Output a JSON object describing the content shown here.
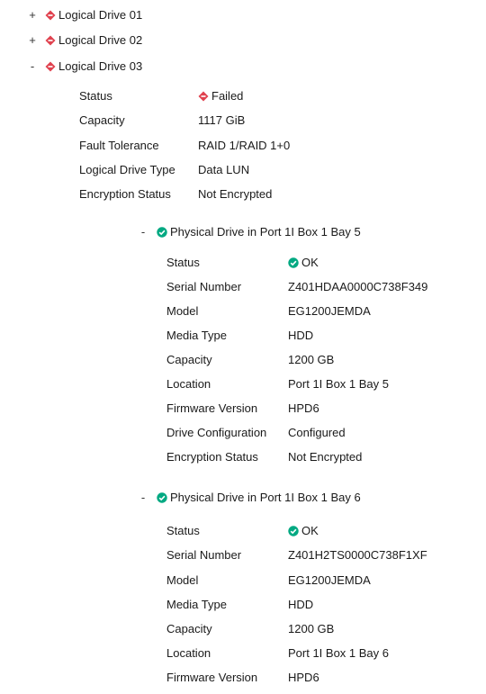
{
  "colors": {
    "failed": "#e0424f",
    "ok": "#01a982"
  },
  "logical_drives": [
    {
      "toggle": "+",
      "name": "Logical Drive 01",
      "status_icon": "failed-icon"
    },
    {
      "toggle": "+",
      "name": "Logical Drive 02",
      "status_icon": "failed-icon"
    },
    {
      "toggle": "-",
      "name": "Logical Drive 03",
      "status_icon": "failed-icon",
      "properties": [
        {
          "label": "Status",
          "value": "Failed",
          "icon": "failed-icon"
        },
        {
          "label": "Capacity",
          "value": "1117 GiB"
        },
        {
          "label": "Fault Tolerance",
          "value": "RAID 1/RAID 1+0"
        },
        {
          "label": "Logical Drive Type",
          "value": "Data LUN"
        },
        {
          "label": "Encryption Status",
          "value": "Not Encrypted"
        }
      ],
      "physical_drives": [
        {
          "toggle": "-",
          "name": "Physical Drive in Port 1I Box 1 Bay 5",
          "status_icon": "ok-icon",
          "properties": [
            {
              "label": "Status",
              "value": "OK",
              "icon": "ok-icon"
            },
            {
              "label": "Serial Number",
              "value": "Z401HDAA0000C738F349"
            },
            {
              "label": "Model",
              "value": "EG1200JEMDA"
            },
            {
              "label": "Media Type",
              "value": "HDD"
            },
            {
              "label": "Capacity",
              "value": "1200 GB"
            },
            {
              "label": "Location",
              "value": "Port 1I Box 1 Bay 5"
            },
            {
              "label": "Firmware Version",
              "value": "HPD6"
            },
            {
              "label": "Drive Configuration",
              "value": "Configured"
            },
            {
              "label": "Encryption Status",
              "value": "Not Encrypted"
            }
          ]
        },
        {
          "toggle": "-",
          "name": "Physical Drive in Port 1I Box 1 Bay 6",
          "status_icon": "ok-icon",
          "properties": [
            {
              "label": "Status",
              "value": "OK",
              "icon": "ok-icon"
            },
            {
              "label": "Serial Number",
              "value": "Z401H2TS0000C738F1XF"
            },
            {
              "label": "Model",
              "value": "EG1200JEMDA"
            },
            {
              "label": "Media Type",
              "value": "HDD"
            },
            {
              "label": "Capacity",
              "value": "1200 GB"
            },
            {
              "label": "Location",
              "value": "Port 1I Box 1 Bay 6"
            },
            {
              "label": "Firmware Version",
              "value": "HPD6"
            }
          ]
        }
      ]
    }
  ]
}
